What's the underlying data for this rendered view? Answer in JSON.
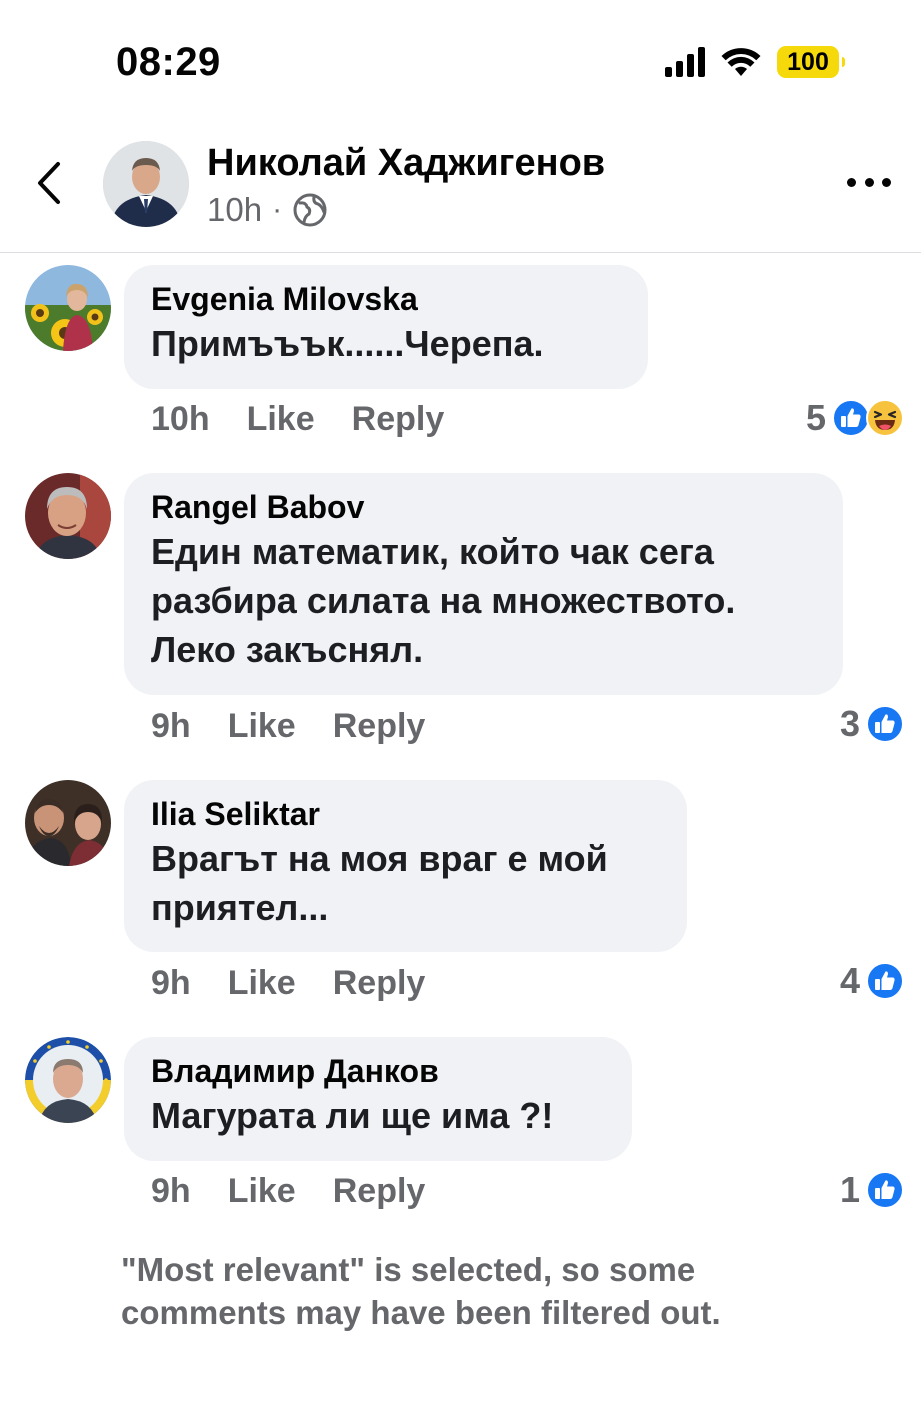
{
  "status_bar": {
    "time": "08:29",
    "battery": "100",
    "battery_color": "#f5d90b"
  },
  "post_header": {
    "author_name": "Николай Хаджигенов",
    "time": "10h",
    "separator": "·",
    "privacy_icon": "globe-icon",
    "back_icon": "chevron-left-icon",
    "more_icon": "more-horizontal-icon"
  },
  "comments": [
    {
      "name": "Evgenia Milovska",
      "text": "Примъъък......Черепа.",
      "time": "10h",
      "like_label": "Like",
      "reply_label": "Reply",
      "reaction_count": "5",
      "reactions": [
        "like-icon",
        "haha-icon"
      ]
    },
    {
      "name": "Rangel Babov",
      "text": "Един математик, който чак сега\nразбира силата на множеството.\nЛеко закъснял.",
      "time": "9h",
      "like_label": "Like",
      "reply_label": "Reply",
      "reaction_count": "3",
      "reactions": [
        "like-icon"
      ]
    },
    {
      "name": "Ilia Seliktar",
      "text": "Врагът на моя враг е мой\nприятел...",
      "time": "9h",
      "like_label": "Like",
      "reply_label": "Reply",
      "reaction_count": "4",
      "reactions": [
        "like-icon"
      ]
    },
    {
      "name": "Владимир Данков",
      "text": "Магурата ли ще има ?!",
      "time": "9h",
      "like_label": "Like",
      "reply_label": "Reply",
      "reaction_count": "1",
      "reactions": [
        "like-icon"
      ]
    }
  ],
  "footer_note": "\"Most relevant\" is selected, so some comments may have been filtered out.",
  "colors": {
    "like_blue": "#1877f2",
    "bubble_bg": "#f0f2f5",
    "secondary_text": "#65676b"
  }
}
